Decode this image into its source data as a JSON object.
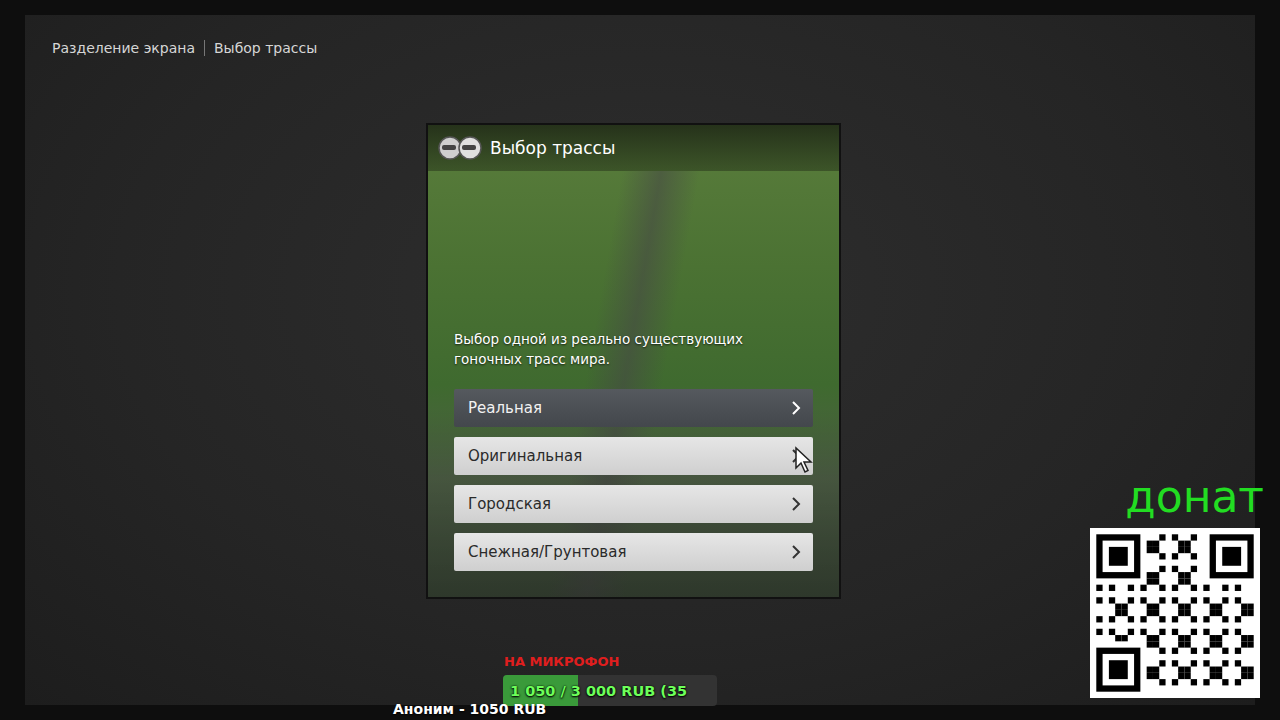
{
  "breadcrumb": [
    "Разделение экрана",
    "Выбор трассы"
  ],
  "dialog": {
    "title": "Выбор трассы",
    "description": "Выбор одной из реально существующих гоночных трасс мира.",
    "options": [
      {
        "label": "Реальная",
        "selected": true
      },
      {
        "label": "Оригинальная",
        "selected": false
      },
      {
        "label": "Городская",
        "selected": false
      },
      {
        "label": "Снежная/Грунтовая",
        "selected": false
      }
    ]
  },
  "overlay": {
    "donate_label": "донат",
    "goal_title": "НА МИКРОФОН",
    "goal_text": "1 050 / 3 000 RUB (35",
    "goal_level": 0.35,
    "last_donation": "Аноним - 1050 RUB"
  }
}
